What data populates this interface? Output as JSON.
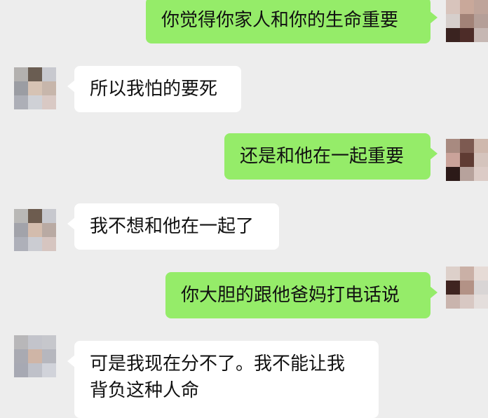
{
  "chat": {
    "messages": [
      {
        "side": "sent",
        "text": "你觉得你家人和你的生命重要"
      },
      {
        "side": "received",
        "text": "所以我怕的要死"
      },
      {
        "side": "sent",
        "text": "还是和他在一起重要"
      },
      {
        "side": "received",
        "text": "我不想和他在一起了"
      },
      {
        "side": "sent",
        "text": "你大胆的跟他爸妈打电话说"
      },
      {
        "side": "received",
        "text": "可是我现在分不了。我不能让我",
        "text2": "背负这种人命"
      }
    ]
  },
  "colors": {
    "background": "#ededed",
    "sent_bubble": "#95ec69",
    "received_bubble": "#ffffff",
    "text": "#111111"
  },
  "icons": {
    "avatar": "pixelated-avatar"
  }
}
